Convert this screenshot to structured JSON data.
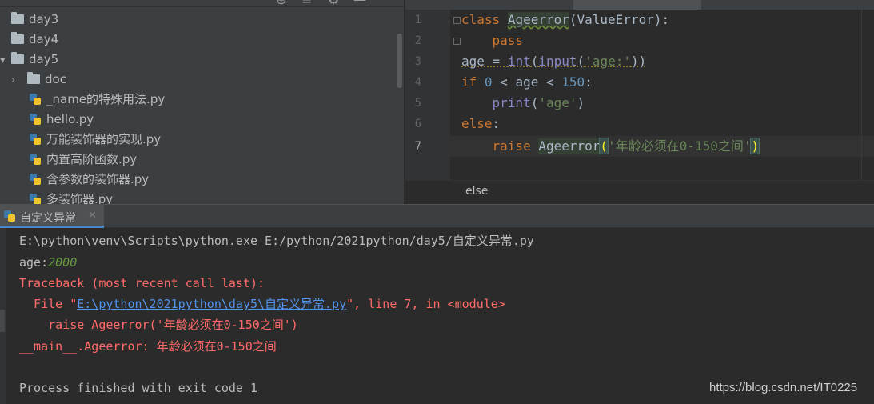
{
  "project_tree": {
    "items": [
      {
        "label": "day3",
        "kind": "folder"
      },
      {
        "label": "day4",
        "kind": "folder"
      },
      {
        "label": "day5",
        "kind": "folder"
      },
      {
        "label": "doc",
        "kind": "folder"
      },
      {
        "label": "_name的特殊用法.py",
        "kind": "file"
      },
      {
        "label": "hello.py",
        "kind": "file"
      },
      {
        "label": "万能装饰器的实现.py",
        "kind": "file"
      },
      {
        "label": "内置高阶函数.py",
        "kind": "file"
      },
      {
        "label": "含参数的装饰器.py",
        "kind": "file"
      },
      {
        "label": "多装饰器.py",
        "kind": "file"
      }
    ]
  },
  "editor": {
    "line_numbers": [
      "1",
      "2",
      "3",
      "4",
      "5",
      "6",
      "7"
    ],
    "current_line": "7",
    "tokens": {
      "class_kw": "class",
      "class_name": "Ageerror",
      "base_open": "(",
      "base_name": "ValueError",
      "base_close": "):",
      "pass_kw": "pass",
      "age_var": "age",
      "assign": " = ",
      "int_fn": "int",
      "paren_open": "(",
      "input_fn": "input",
      "input_prompt": "'age:'",
      "paren_close": "))",
      "if_kw": "if",
      "zero": "0",
      "lt1": " < age < ",
      "limit": "150",
      "colon": ":",
      "print_fn": "print",
      "print_open": "(",
      "print_arg": "'age'",
      "print_close": ")",
      "else_kw": "else",
      "else_colon": ":",
      "raise_kw": "raise",
      "raise_name": "Ageerror",
      "raise_open": "(",
      "raise_msg": "'年龄必须在0-150之间'",
      "raise_close": ")"
    },
    "breadcrumb": "else"
  },
  "run_panel": {
    "tab_label": "自定义异常",
    "close_glyph": "✕",
    "console": {
      "command": "E:\\python\\venv\\Scripts\\python.exe E:/python/2021python/day5/自定义异常.py",
      "prompt": "age:",
      "input_value": "2000",
      "traceback_header": "Traceback (most recent call last):",
      "file_prefix": "  File \"",
      "file_link": "E:\\python\\2021python\\day5\\自定义异常.py",
      "file_suffix": "\", line 7, in <module>",
      "raise_line": "    raise Ageerror('年龄必须在0-150之间')",
      "error_line": "__main__.Ageerror: 年龄必须在0-150之间",
      "exit_line": "Process finished with exit code 1"
    }
  },
  "watermark": "https://blog.csdn.net/IT0225",
  "colors": {
    "keyword": "#cc7832",
    "string": "#6a8759",
    "number": "#6897bb",
    "builtin": "#8888c6",
    "error": "#ff6b68",
    "link": "#5394ec",
    "accent": "#4a88c7"
  }
}
